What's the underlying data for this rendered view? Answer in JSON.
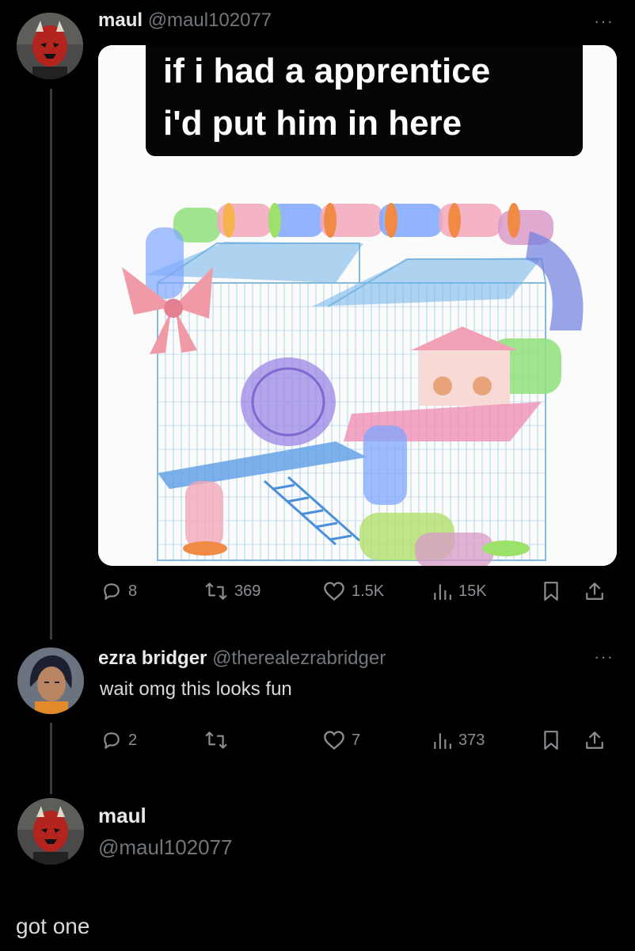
{
  "tweet": {
    "author": "maul",
    "handle": "@maul102077",
    "more": "···",
    "caption_line1": "if i had a apprentice",
    "caption_line2": "i'd put him in here",
    "stats": {
      "replies": "8",
      "reposts": "369",
      "likes": "1.5K",
      "views": "15K"
    }
  },
  "reply": {
    "author": "ezra bridger",
    "handle": "@therealezrabridger",
    "more": "···",
    "text": "wait omg this looks fun",
    "stats": {
      "replies": "2",
      "reposts": "",
      "likes": "7",
      "views": "373"
    }
  },
  "final": {
    "author": "maul",
    "handle": "@maul102077",
    "text": "got one"
  },
  "colors": {
    "background": "#000000",
    "text": "#e7e9ea",
    "muted": "#71767b"
  }
}
